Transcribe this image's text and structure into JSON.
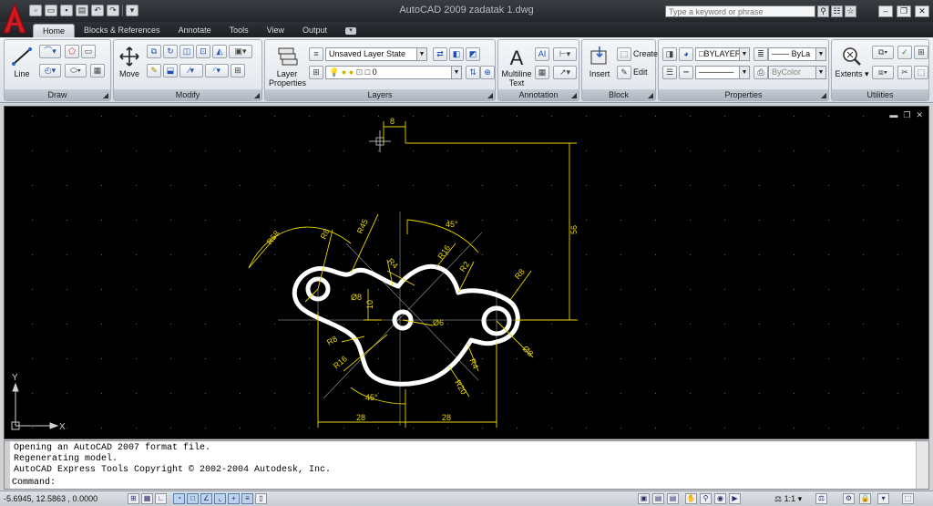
{
  "window": {
    "title": "AutoCAD 2009  zadatak 1.dwg",
    "search_placeholder": "Type a keyword or phrase"
  },
  "tabs": [
    {
      "label": "Home"
    },
    {
      "label": "Blocks & References"
    },
    {
      "label": "Annotate"
    },
    {
      "label": "Tools"
    },
    {
      "label": "View"
    },
    {
      "label": "Output"
    }
  ],
  "ribbon": {
    "draw": {
      "title": "Draw",
      "line_label": "Line"
    },
    "modify": {
      "title": "Modify",
      "move_label": "Move"
    },
    "layers": {
      "title": "Layers",
      "layer_properties_label": "Layer Properties",
      "layer_state": "Unsaved Layer State",
      "current_layer": "0"
    },
    "annotation": {
      "title": "Annotation",
      "multiline_text_label": "Multiline Text"
    },
    "block": {
      "title": "Block",
      "insert_label": "Insert",
      "create_label": "Create",
      "edit_label": "Edit"
    },
    "properties": {
      "title": "Properties",
      "color": "BYLAYER",
      "lineweight": "ByLa",
      "plotstyle": "ByColor"
    },
    "utilities": {
      "title": "Utilities",
      "extents_label": "Extents"
    }
  },
  "drawing": {
    "dimensions": {
      "top_gap": "8",
      "height_56": "56",
      "r58": "R58",
      "r8_a": "R8",
      "r45": "R45",
      "angle_45_top": "45°",
      "r4_a": "R4",
      "r16_a": "R16",
      "r2": "R2",
      "r8_b": "R8",
      "d10": "10",
      "dia8_a": "Ø8",
      "dia6": "Ø6",
      "dia8_b": "Ø8",
      "r8_c": "R8",
      "r16_b": "R16",
      "r4_b": "R4",
      "r20": "R20",
      "angle_45_bottom": "45°",
      "w28_left": "28",
      "w28_right": "28"
    },
    "ucs": {
      "x_label": "X",
      "y_label": "Y"
    }
  },
  "command_history": [
    "Opening an AutoCAD 2007 format file.",
    "Regenerating model.",
    "AutoCAD Express Tools Copyright © 2002-2004 Autodesk, Inc."
  ],
  "command_prompt": "Command:",
  "status": {
    "coordinates": "-5.6945, 12.5863 , 0.0000",
    "annotation_scale": "1:1"
  }
}
